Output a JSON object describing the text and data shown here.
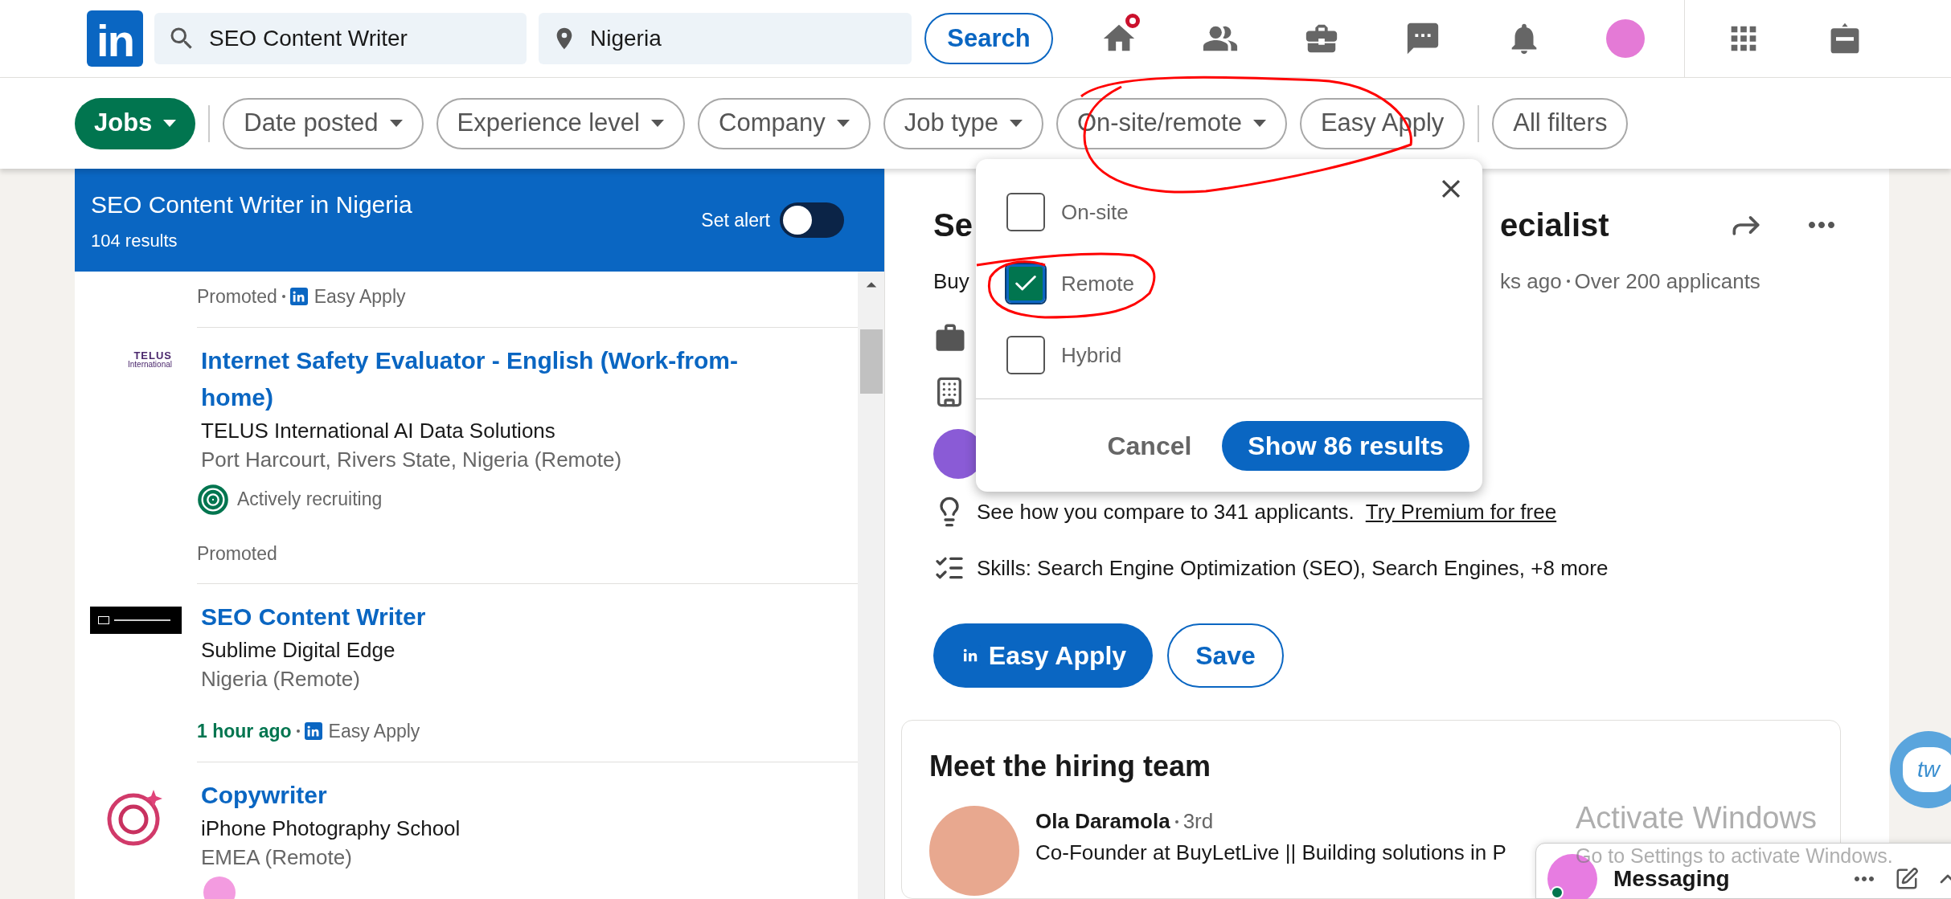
{
  "header": {
    "logo": "in",
    "search": {
      "value": "SEO Content Writer"
    },
    "location": {
      "value": "Nigeria"
    },
    "search_button": "Search",
    "nav": [
      {
        "kind": "home",
        "badge": true
      },
      {
        "kind": "network",
        "badge": false
      },
      {
        "kind": "jobs",
        "badge": false
      },
      {
        "kind": "messaging",
        "badge": false
      },
      {
        "kind": "notifications",
        "badge": false
      },
      {
        "kind": "me",
        "badge": false
      },
      {
        "kind": "apps",
        "badge": false
      },
      {
        "kind": "post-job",
        "badge": false
      }
    ]
  },
  "filters": [
    {
      "label": "Jobs",
      "selected": true,
      "dropdown": true,
      "divider_after": true
    },
    {
      "label": "Date posted",
      "selected": false,
      "dropdown": true,
      "divider_after": false
    },
    {
      "label": "Experience level",
      "selected": false,
      "dropdown": true,
      "divider_after": false
    },
    {
      "label": "Company",
      "selected": false,
      "dropdown": true,
      "divider_after": false
    },
    {
      "label": "Job type",
      "selected": false,
      "dropdown": true,
      "divider_after": false
    },
    {
      "label": "On-site/remote",
      "selected": false,
      "dropdown": true,
      "divider_after": false
    },
    {
      "label": "Easy Apply",
      "selected": false,
      "dropdown": false,
      "divider_after": true
    },
    {
      "label": "All filters",
      "selected": false,
      "dropdown": false,
      "divider_after": false
    }
  ],
  "results": {
    "title": "SEO Content Writer in Nigeria",
    "count": "104 results",
    "alert_label": "Set alert",
    "alert_on": false
  },
  "jobs": [
    {
      "footer": [
        {
          "kind": "promoted",
          "text": "Promoted"
        },
        {
          "kind": "easy-apply",
          "text": "Easy Apply"
        }
      ]
    },
    {
      "logo": {
        "kind": "telus",
        "text": [
          "TELUS",
          "International"
        ]
      },
      "title": "Internet Safety Evaluator - English (Work-from-home)",
      "company": "TELUS International AI Data Solutions",
      "location": "Port Harcourt, Rivers State, Nigeria (Remote)",
      "insight": "Actively recruiting",
      "footer": [
        {
          "kind": "promoted",
          "text": "Promoted"
        }
      ]
    },
    {
      "logo": {
        "kind": "sublime"
      },
      "title": "SEO Content Writer",
      "company": "Sublime Digital Edge",
      "location": "Nigeria (Remote)",
      "footer": [
        {
          "kind": "time",
          "text": "1 hour ago"
        },
        {
          "kind": "easy-apply",
          "text": "Easy Apply"
        }
      ]
    },
    {
      "logo": {
        "kind": "ring"
      },
      "title": "Copywriter",
      "company": "iPhone Photography School",
      "location": "EMEA (Remote)",
      "connection_avatar": true
    }
  ],
  "detail": {
    "title_parts": [
      "Se",
      "ecialist"
    ],
    "subtitle_parts": [
      "Buy",
      "ks ago",
      "Over 200 applicants"
    ],
    "insights": [
      {
        "kind": "compare",
        "text": "See how you compare to 341 applicants.",
        "link": "Try Premium for free"
      },
      {
        "kind": "skills",
        "text": "Skills: Search Engine Optimization (SEO), Search Engines, +8 more"
      }
    ],
    "apply_button": "Easy Apply",
    "save_button": "Save",
    "hiring": {
      "heading": "Meet the hiring team",
      "people": [
        {
          "name": "Ola Daramola",
          "degree": "3rd",
          "headline": "Co-Founder at BuyLetLive || Building solutions in P"
        }
      ]
    }
  },
  "dropdown": {
    "options": [
      {
        "label": "On-site",
        "checked": false
      },
      {
        "label": "Remote",
        "checked": true
      },
      {
        "label": "Hybrid",
        "checked": false
      }
    ],
    "cancel": "Cancel",
    "confirm": "Show 86 results"
  },
  "messaging": {
    "label": "Messaging",
    "online": true
  },
  "widget_label": "tw",
  "os_overlay": {
    "title": "Activate Windows",
    "subtitle": "Go to Settings to activate Windows."
  }
}
